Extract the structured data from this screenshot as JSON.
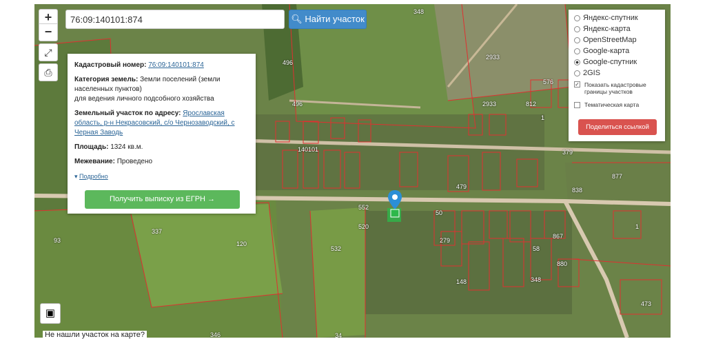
{
  "search": {
    "value": "76:09:140101:874",
    "button_label": "Найти участок"
  },
  "zoom": {
    "in": "+",
    "out": "−"
  },
  "info": {
    "cadastral_label": "Кадастровый номер:",
    "cadastral_value": "76:09:140101:874",
    "category_label": "Категория земель:",
    "category_value": "Земли поселений (земли населенных пунктов)",
    "category_use": "для ведения личного подсобного хозяйства",
    "address_label": "Земельный участок по адресу:",
    "address_value": "Ярославская область, р-н Некрасовский, с/о Чернозаводский, с Черная Заводь",
    "area_label": "Площадь:",
    "area_value": "1324 кв.м.",
    "survey_label": "Межевание:",
    "survey_value": "Проведено",
    "details_link": "Подробно",
    "egrn_button": "Получить выписку из ЕГРН →"
  },
  "layers": {
    "options": [
      {
        "label": "Яндекс-спутник",
        "selected": false
      },
      {
        "label": "Яндекс-карта",
        "selected": false
      },
      {
        "label": "OpenStreetMap",
        "selected": false
      },
      {
        "label": "Google-карта",
        "selected": false
      },
      {
        "label": "Google-спутник",
        "selected": true
      },
      {
        "label": "2GIS",
        "selected": false
      }
    ],
    "show_borders": "Показать кадастровые границы участков",
    "thematic": "Тематическая карта",
    "share_button": "Поделиться ссылкой"
  },
  "bottom_text": "Не нашли участок на карте?",
  "parcel_labels": [
    "348",
    "2933",
    "2933",
    "496",
    "496",
    "812",
    "576",
    "1",
    "140101",
    "552",
    "520",
    "120",
    "337",
    "93",
    "532",
    "379",
    "838",
    "877",
    "1",
    "479",
    "50",
    "279",
    "867",
    "58",
    "880",
    "148",
    "348",
    "473",
    "346",
    "34"
  ],
  "colors": {
    "search_button": "#428bca",
    "egrn_button": "#5cb85c",
    "share_button": "#d9534f",
    "parcel_border": "#e03030"
  }
}
